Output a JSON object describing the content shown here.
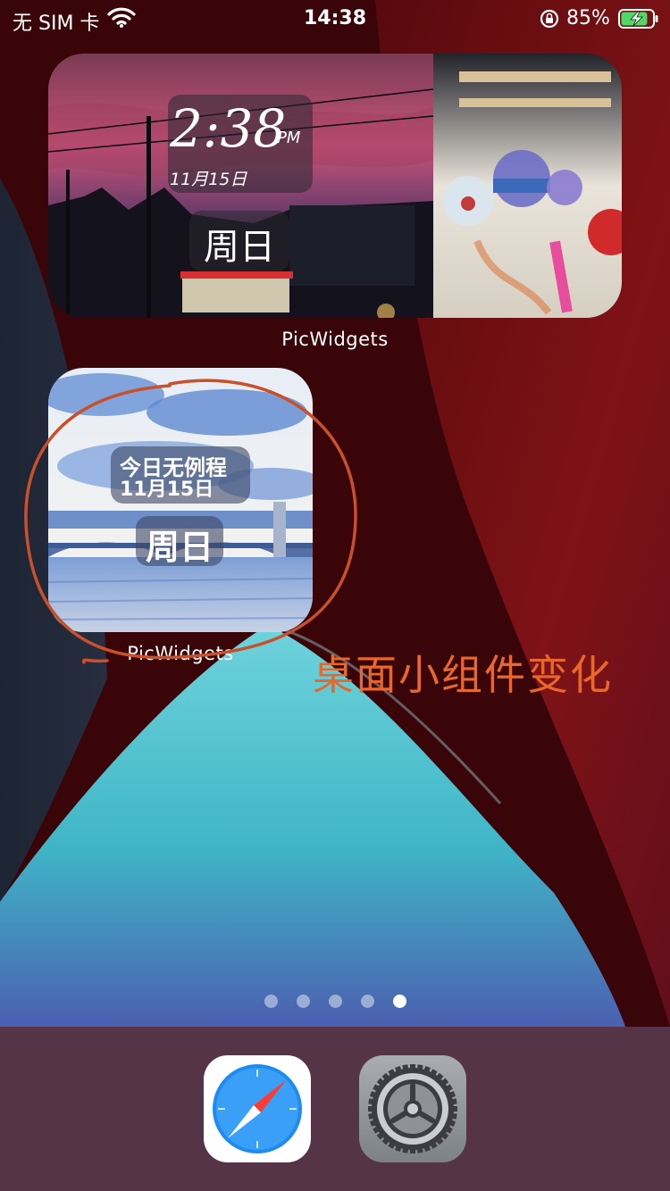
{
  "status_bar": {
    "carrier": "无 SIM 卡",
    "time": "14:38",
    "battery_percent": "85%",
    "battery_level": 0.85,
    "charging": true
  },
  "widgets": [
    {
      "label": "PicWidgets",
      "clock": {
        "time": "2:38",
        "ampm": "PM",
        "date": "11月15日"
      },
      "day": "周日"
    },
    {
      "label": "PicWidgets",
      "schedule": "今日无例程",
      "date": "11月15日",
      "day": "周日"
    }
  ],
  "annotation": "桌面小组件变化",
  "page_indicator": {
    "total": 5,
    "active": 5
  },
  "dock": {
    "apps": [
      {
        "icon": "safari-icon"
      },
      {
        "icon": "settings-gear-icon"
      }
    ]
  },
  "colors": {
    "annotation": "#e8672c",
    "wallpaper_red": "#8a1518",
    "wallpaper_teal": "#3fb6c7"
  }
}
